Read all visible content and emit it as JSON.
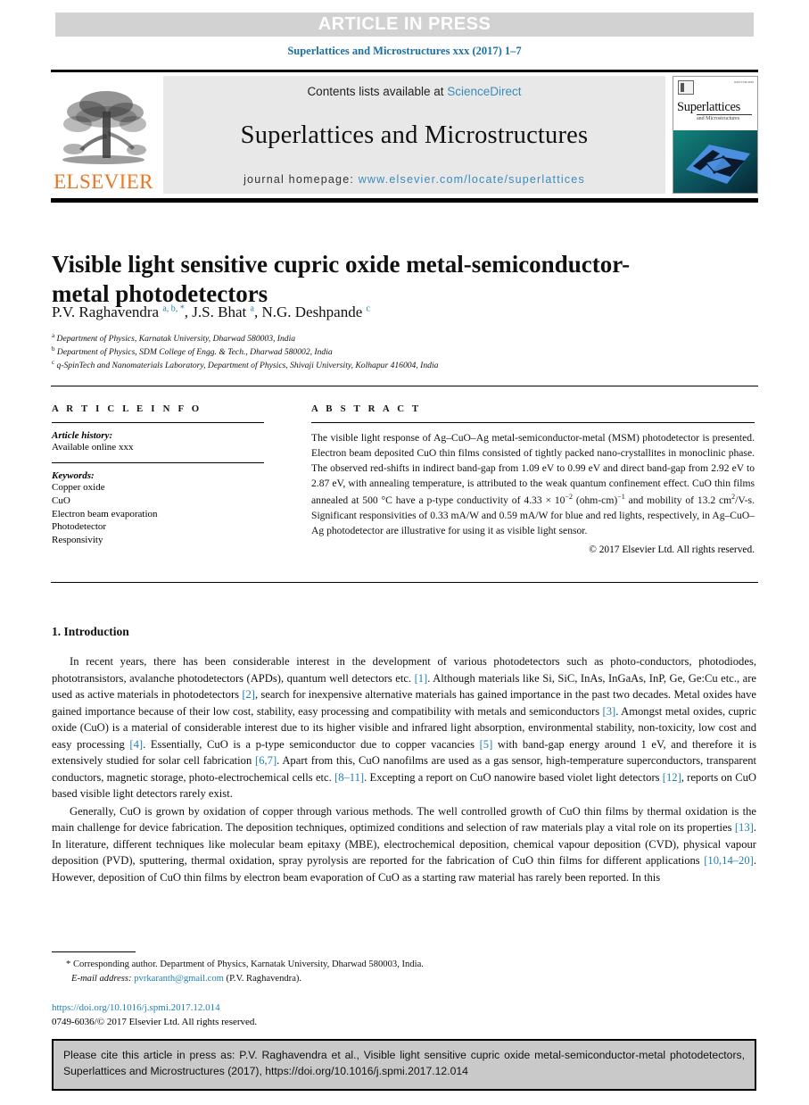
{
  "banner": {
    "text": "ARTICLE IN PRESS"
  },
  "running_head": "Superlattices and Microstructures xxx (2017) 1–7",
  "masthead": {
    "contents_prefix": "Contents lists available at ",
    "sciencedirect": "ScienceDirect",
    "journal_name": "Superlattices and Microstructures",
    "homepage_label": "journal homepage: ",
    "homepage_url": "www.elsevier.com/locate/superlattices",
    "publisher": "ELSEVIER",
    "cover": {
      "title": "Superlattices",
      "subtitle": "and Microstructures",
      "issn": "ISSN 0749-6036"
    }
  },
  "article": {
    "title": "Visible light sensitive cupric oxide metal-semiconductor-metal photodetectors",
    "authors_html": "P.V. Raghavendra <sup>a, b, *</sup>, J.S. Bhat <sup>a</sup>, N.G. Deshpande <sup>c</sup>",
    "affiliations": [
      {
        "marker": "a",
        "text": "Department of Physics, Karnatak University, Dharwad 580003, India"
      },
      {
        "marker": "b",
        "text": "Department of Physics, SDM College of Engg. & Tech., Dharwad 580002, India"
      },
      {
        "marker": "c",
        "text": "q-SpinTech and Nanomaterials Laboratory, Department of Physics, Shivaji University, Kolhapur 416004, India"
      }
    ]
  },
  "article_info": {
    "heading": "A R T I C L E  I N F O",
    "history_label": "Article history:",
    "history_value": "Available online xxx",
    "keywords_label": "Keywords:",
    "keywords": [
      "Copper oxide",
      "CuO",
      "Electron beam evaporation",
      "Photodetector",
      "Responsivity"
    ]
  },
  "abstract": {
    "heading": "A B S T R A C T",
    "text_html": "The visible light response of Ag–CuO–Ag metal-semiconductor-metal (MSM) photodetector is presented. Electron beam deposited CuO thin films consisted of tightly packed nano-crystallites in monoclinic phase. The observed red-shifts in indirect band-gap from 1.09 eV to 0.99 eV and direct band-gap from 2.92 eV to 2.87 eV, with annealing temperature, is attributed to the weak quantum confinement effect. CuO thin films annealed at 500 °C have a p-type conductivity of 4.33 × 10<sup class=\"sm\">−2</sup> (ohm-cm)<sup class=\"sm\">−1</sup> and mobility of 13.2 cm<sup class=\"sm\">2</sup>/V-s. Significant responsivities of 0.33 mA/W and 0.59 mA/W for blue and red lights, respectively, in Ag–CuO–Ag photodetector are illustrative for using it as visible light sensor.",
    "copyright": "© 2017 Elsevier Ltd. All rights reserved."
  },
  "body": {
    "section_heading": "1. Introduction",
    "paragraphs_html": [
      "In recent years, there has been considerable interest in the development of various photodetectors such as photo-conductors, photodiodes, phototransistors, avalanche photodetectors (APDs), quantum well detectors etc. <span class=\"ref\">[1]</span>. Although materials like Si, SiC, InAs, InGaAs, InP, Ge, Ge:Cu etc., are used as active materials in photodetectors <span class=\"ref\">[2]</span>, search for inexpensive alternative materials has gained importance in the past two decades. Metal oxides have gained importance because of their low cost, stability, easy processing and compatibility with metals and semiconductors <span class=\"ref\">[3]</span>. Amongst metal oxides, cupric oxide (CuO) is a material of considerable interest due to its higher visible and infrared light absorption, environmental stability, non-toxicity, low cost and easy processing <span class=\"ref\">[4]</span>. Essentially, CuO is a p-type semiconductor due to copper vacancies <span class=\"ref\">[5]</span> with band-gap energy around 1 eV, and therefore it is extensively studied for solar cell fabrication <span class=\"ref\">[6,7]</span>. Apart from this, CuO nanofilms are used as a gas sensor, high-temperature superconductors, transparent conductors, magnetic storage, photo-electrochemical cells etc. <span class=\"ref\">[8–11]</span>. Excepting a report on CuO nanowire based violet light detectors <span class=\"ref\">[12]</span>, reports on CuO based visible light detectors rarely exist.",
      "Generally, CuO is grown by oxidation of copper through various methods. The well controlled growth of CuO thin films by thermal oxidation is the main challenge for device fabrication. The deposition techniques, optimized conditions and selection of raw materials play a vital role on its properties <span class=\"ref\">[13]</span>. In literature, different techniques like molecular beam epitaxy (MBE), electrochemical deposition, chemical vapour deposition (CVD), physical vapour deposition (PVD), sputtering, thermal oxidation, spray pyrolysis are reported for the fabrication of CuO thin films for different applications <span class=\"ref\">[10,14–20]</span>. However, deposition of CuO thin films by electron beam evaporation of CuO as a starting raw material has rarely been reported. In this"
    ]
  },
  "footnote": {
    "corresponding_marker": "*",
    "corresponding_text": "Corresponding author. Department of Physics, Karnatak University, Dharwad 580003, India.",
    "email_label": "E-mail address:",
    "email": "pvrkaranth@gmail.com",
    "email_owner": "(P.V. Raghavendra)."
  },
  "doi": {
    "url": "https://doi.org/10.1016/j.spmi.2017.12.014",
    "issn_line": "0749-6036/© 2017 Elsevier Ltd. All rights reserved."
  },
  "citation_box": {
    "text": "Please cite this article in press as: P.V. Raghavendra et al., Visible light sensitive cupric oxide metal-semiconductor-metal photodetectors, Superlattices and Microstructures (2017), https://doi.org/10.1016/j.spmi.2017.12.014"
  },
  "colors": {
    "banner_bg": "#d2d2d2",
    "link_blue": "#1f7fb0",
    "elsevier_orange": "#E87722",
    "mast_bg": "#e8e8e8",
    "cite_bg": "#c9c9c9"
  }
}
